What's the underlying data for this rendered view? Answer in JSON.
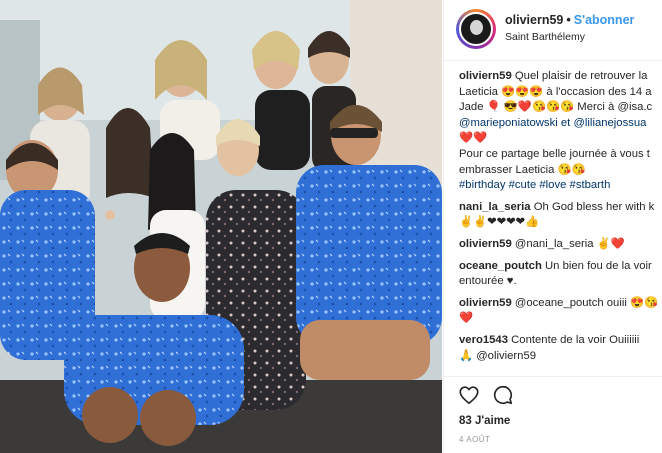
{
  "header": {
    "username": "oliviern59",
    "dot": "•",
    "follow_label": "S'abonner",
    "location": "Saint Barthélemy"
  },
  "comments": [
    {
      "user": "oliviern59",
      "lines": [
        "Quel plaisir de retrouver la",
        "Laeticia 😍😍😍 à l'occasion des 14 a",
        "Jade 🎈 😎❤️😘😘😘 Merci à @isa.c",
        "@marieponiatowski et @lilianejossua",
        "❤️❤️",
        "Pour ce partage belle journée à vous t",
        "embrasser Laeticia 😘😘",
        "#birthday #cute #love #stbarth"
      ]
    },
    {
      "user": "nani_la_seria",
      "lines": [
        "Oh God bless her with k",
        "✌️✌️❤❤❤❤👍"
      ]
    },
    {
      "user": "oliviern59",
      "lines": [
        "@nani_la_seria ✌️❤️"
      ]
    },
    {
      "user": "oceane_poutch",
      "lines": [
        "Un bien fou de la voir",
        "entourée ♥."
      ]
    },
    {
      "user": "oliviern59",
      "lines": [
        "@oceane_poutch ouiii 😍😘",
        "❤️"
      ]
    },
    {
      "user": "vero1543",
      "lines": [
        "Contente de la voir Ouiiiiii",
        "🙏 @oliviern59"
      ]
    }
  ],
  "actions": {
    "like_icon": "heart-outline-icon",
    "comment_icon": "speech-bubble-icon",
    "likes": "83 J'aime",
    "date": "4 AOÛT"
  },
  "photo": {
    "description_icon": "group-photo"
  }
}
